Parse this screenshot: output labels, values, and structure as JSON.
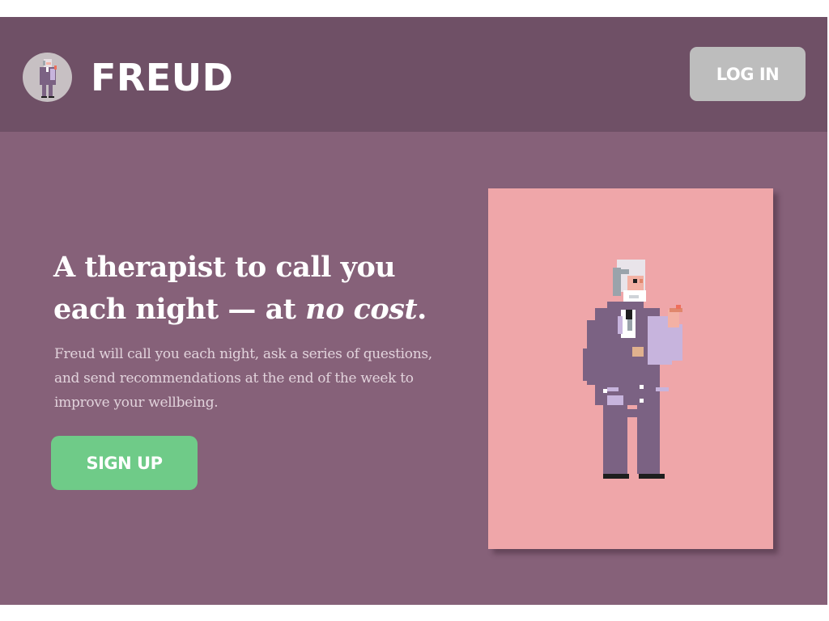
{
  "header": {
    "brand": "FREUD",
    "login_label": "LOG IN"
  },
  "hero": {
    "headline_part1": "A therapist to call you each night — at ",
    "headline_emphasis": "no cost",
    "headline_part2": ".",
    "description": "Freud will call you each night, ask a series of questions, and send recommendations at the end of the week to improve your wellbeing.",
    "signup_label": "SIGN UP"
  },
  "colors": {
    "background": "#866179",
    "header": "#6f5066",
    "login_button": "#bdbdbd",
    "signup_button": "#6fcb88",
    "art_card": "#efa6a9"
  },
  "icons": {
    "logo": "freud-pixel-avatar-icon",
    "illustration": "freud-pixel-illustration"
  }
}
